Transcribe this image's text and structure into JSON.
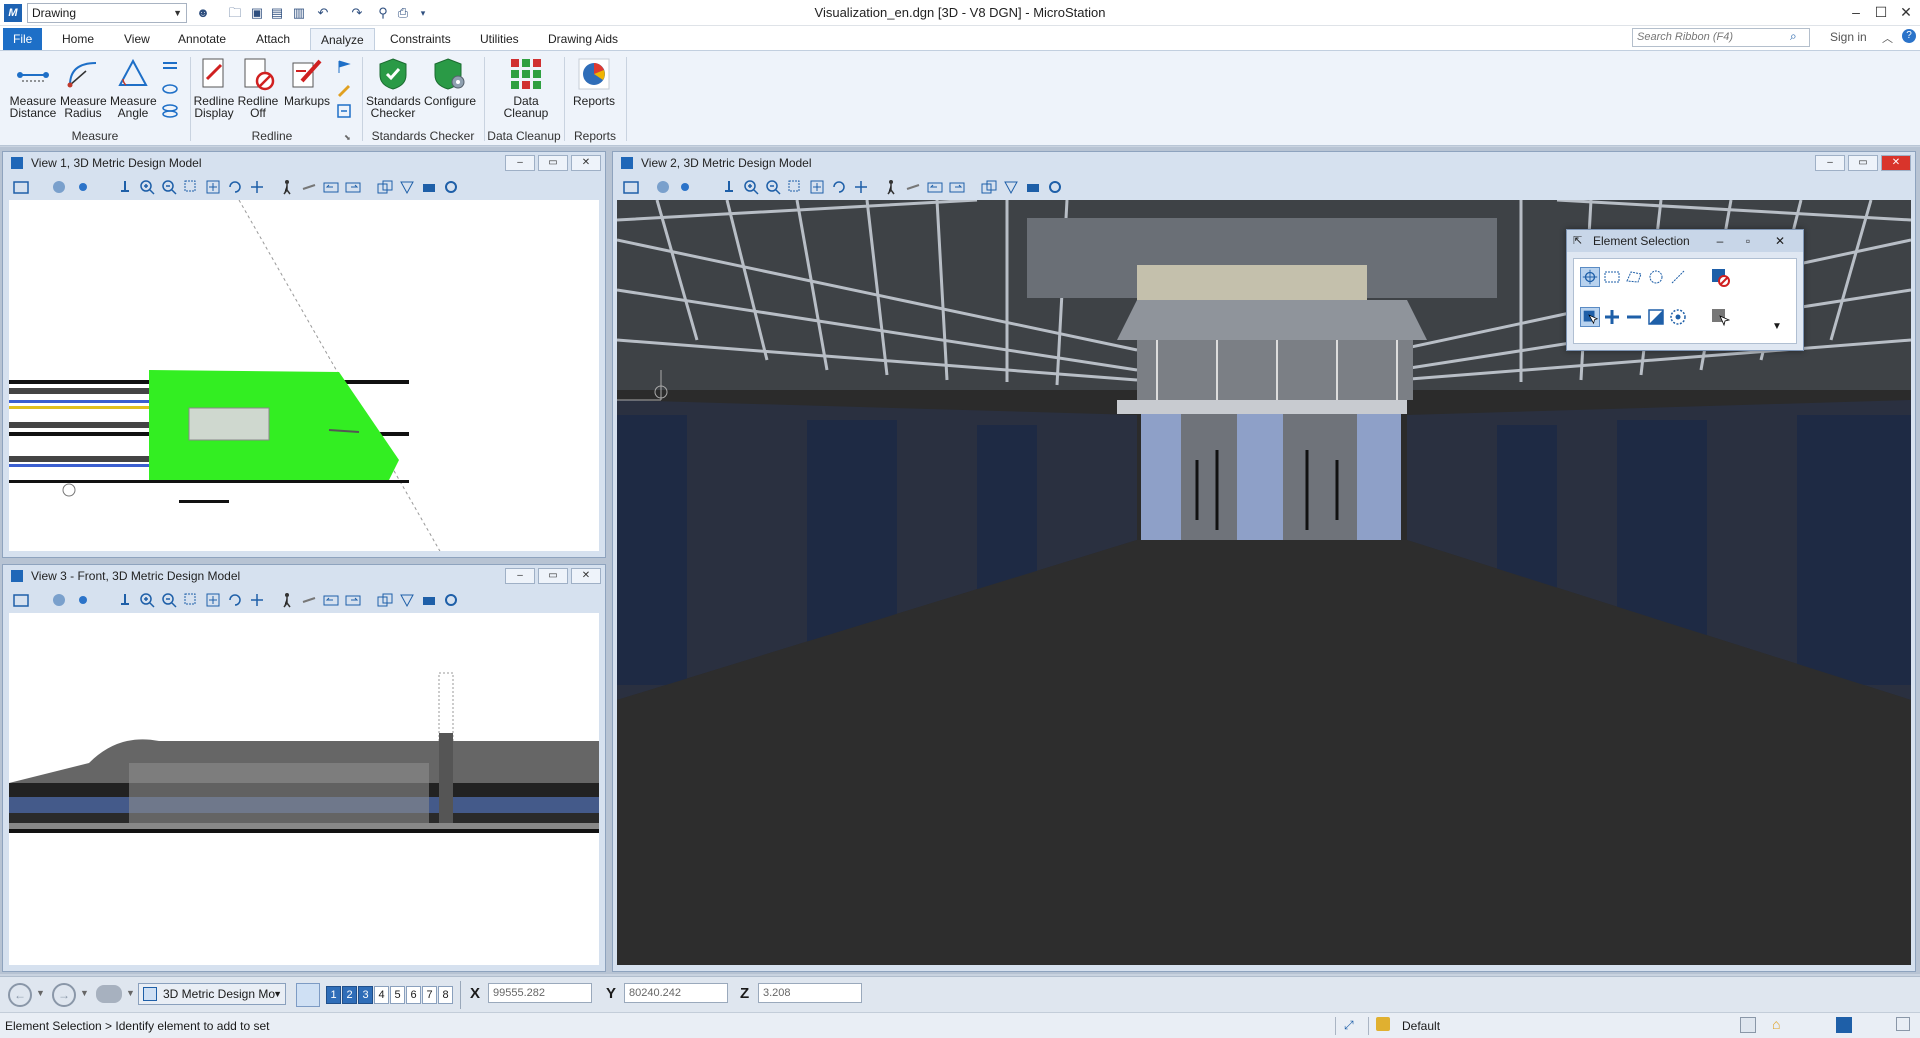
{
  "titlebar": {
    "workflow": "Drawing",
    "title": "Visualization_en.dgn [3D - V8 DGN] - MicroStation"
  },
  "ribbon_tabs": [
    "File",
    "Home",
    "View",
    "Annotate",
    "Attach",
    "Analyze",
    "Constraints",
    "Utilities",
    "Drawing Aids"
  ],
  "active_tab": "Analyze",
  "search": {
    "placeholder": "Search Ribbon (F4)"
  },
  "signin": "Sign in",
  "ribbon": {
    "measure": {
      "group": "Measure",
      "distance": "Measure Distance",
      "radius": "Measure Radius",
      "angle": "Measure Angle"
    },
    "redline": {
      "group": "Redline",
      "display": "Redline Display",
      "off": "Redline Off",
      "markups": "Markups"
    },
    "standards": {
      "group": "Standards Checker",
      "checker": "Standards Checker",
      "configure": "Configure"
    },
    "cleanup": {
      "group": "Data Cleanup",
      "data_cleanup": "Data Cleanup"
    },
    "reports": {
      "group": "Reports",
      "reports": "Reports"
    }
  },
  "views": {
    "view1": "View 1, 3D Metric Design Model",
    "view2": "View 2, 3D Metric Design Model",
    "view3": "View 3 - Front, 3D Metric Design Model"
  },
  "element_selection": {
    "title": "Element Selection"
  },
  "bottombar": {
    "model": "3D Metric Design Mo",
    "view_numbers": [
      "1",
      "2",
      "3",
      "4",
      "5",
      "6",
      "7",
      "8"
    ],
    "active_views": [
      "1",
      "2",
      "3"
    ],
    "x_label": "X",
    "x_value": "99555.282",
    "y_label": "Y",
    "y_value": "80240.242",
    "z_label": "Z",
    "z_value": "3.208"
  },
  "status": {
    "prompt": "Element Selection > Identify element to add to set",
    "level": "Default"
  },
  "colors": {
    "accent": "#1e6fc7",
    "green_highlight": "#33ee22",
    "floor": "#2b2b2b"
  }
}
